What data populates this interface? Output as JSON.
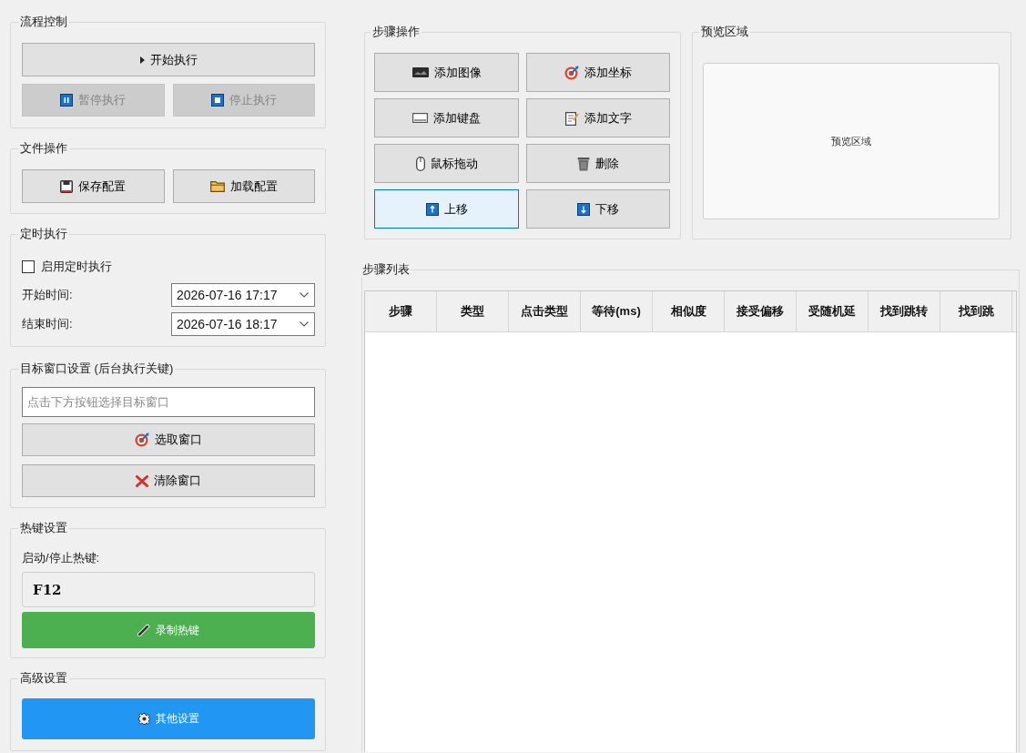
{
  "flow_control": {
    "title": "流程控制",
    "buttons": [
      {
        "label": "开始执行",
        "disabled": false
      },
      {
        "label": "暂停执行",
        "disabled": true
      },
      {
        "label": "停止执行",
        "disabled": true
      }
    ]
  },
  "file_operations": {
    "title": "文件操作",
    "buttons": [
      {
        "label": "保存配置"
      },
      {
        "label": "加载配置"
      }
    ]
  },
  "scheduled_run": {
    "title": "定时执行",
    "enable": {
      "label": "启用定时执行",
      "checked": false
    },
    "times": [
      {
        "label": "开始时间:",
        "value": "2026-07-16 17:17"
      },
      {
        "label": "结束时间:",
        "value": "2026-07-16 18:17"
      }
    ]
  },
  "target_window": {
    "title": "目标窗口设置 (后台执行关键)",
    "window_field": {
      "placeholder": "点击下方按钮选择目标窗口"
    },
    "buttons": [
      {
        "label": "选取窗口"
      },
      {
        "label": "清除窗口"
      }
    ]
  },
  "hotkey_settings": {
    "title": "热键设置",
    "label": "启动/停止热键:",
    "hotkey_field": {
      "value": "F12"
    },
    "record_button": {
      "label": "录制热键"
    }
  },
  "advanced_settings": {
    "title": "高级设置",
    "button": {
      "label": "其他设置"
    }
  },
  "step_operations": {
    "title": "步骤操作",
    "buttons": [
      {
        "label": "添加图像",
        "focused": false
      },
      {
        "label": "添加坐标",
        "focused": false
      },
      {
        "label": "添加键盘",
        "focused": false
      },
      {
        "label": "添加文字",
        "focused": false
      },
      {
        "label": "鼠标拖动",
        "focused": false
      },
      {
        "label": "删除",
        "focused": false
      },
      {
        "label": "上移",
        "focused": true
      },
      {
        "label": "下移",
        "focused": false
      }
    ]
  },
  "preview": {
    "title": "预览区域",
    "text": "预览区域"
  },
  "step_list": {
    "title": "步骤列表",
    "table": {
      "columns": [
        "步骤",
        "类型",
        "点击类型",
        "等待(ms)",
        "相似度",
        "接受偏移",
        "受随机延",
        "找到跳转",
        "找到跳"
      ]
    }
  }
}
